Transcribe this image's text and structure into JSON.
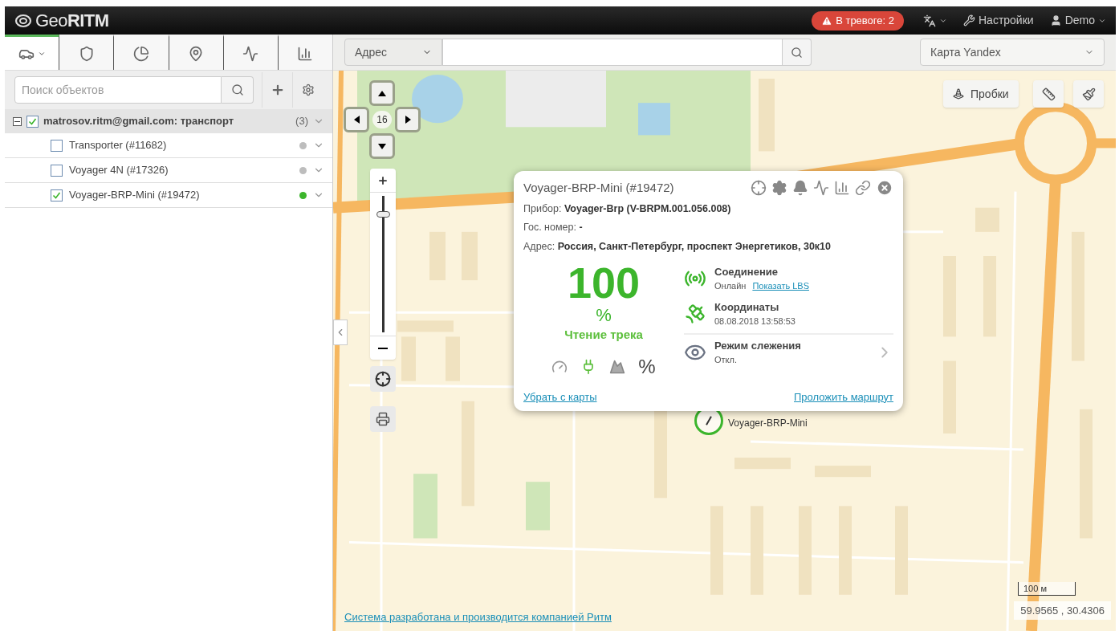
{
  "header": {
    "logo_light": "Geo",
    "logo_bold": "RITM",
    "alarm": "В тревоге: 2",
    "settings": "Настройки",
    "user": "Demo"
  },
  "sidebar": {
    "tabs": [
      {
        "kind": "car",
        "selected": true
      },
      {
        "kind": "shield",
        "selected": false
      },
      {
        "kind": "pie",
        "selected": false
      },
      {
        "kind": "pin",
        "selected": false
      },
      {
        "kind": "track",
        "selected": false
      },
      {
        "kind": "chart",
        "selected": false
      }
    ],
    "search": {
      "placeholder": "Поиск объектов"
    },
    "group": {
      "label": "matrosov.ritm@gmail.com: транспорт",
      "count": "(3)",
      "checked": true,
      "expanded": true,
      "children": [
        {
          "label": "Transporter (#11682)",
          "checked": false,
          "color": "#bdbdbd"
        },
        {
          "label": "Voyager 4N (#17326)",
          "checked": false,
          "color": "#bdbdbd"
        },
        {
          "label": "Voyager-BRP-Mini (#19472)",
          "checked": true,
          "color": "#3cb52c"
        }
      ]
    }
  },
  "toolbar": {
    "address_mode": "Адрес",
    "map_type": "Карта Yandex"
  },
  "map": {
    "zoom": "16",
    "zoom_slider": {
      "level": 0.88
    },
    "traffic": "Пробки",
    "marker_label": "Voyager-BRP-Mini",
    "scale": "100 м",
    "coordinates": "59.9565 , 30.4306",
    "footer_link": "Система разработана и производится компанией Ритм"
  },
  "popup": {
    "title": "Voyager-BRP-Mini (#19472)",
    "details": [
      {
        "label": "Прибор:",
        "value": "Voyager-Brp (V-BRPM.001.056.008)"
      },
      {
        "label": "Гос. номер:",
        "value": "-"
      },
      {
        "label": "Адрес:",
        "value": "Россия, Санкт-Петербург, проспект Энергетиков, 30к10"
      }
    ],
    "progress_value": "100",
    "progress_unit": "%",
    "progress_label": "Чтение трека",
    "percent_sign": "%",
    "status": [
      {
        "kind": "connection",
        "title": "Соединение",
        "value": "Онлайн",
        "link": "Показать LBS"
      },
      {
        "kind": "coordinates",
        "title": "Координаты",
        "value": "08.08.2018 13:58:53"
      },
      {
        "kind": "tracking",
        "title": "Режим слежения",
        "value": "Откл."
      }
    ],
    "remove_link": "Убрать с карты",
    "route_link": "Проложить маршрут"
  }
}
